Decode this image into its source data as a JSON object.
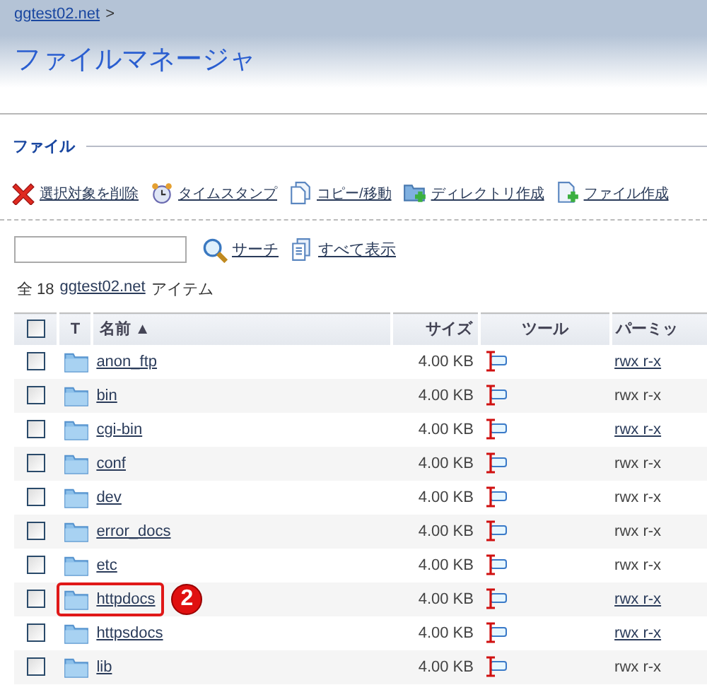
{
  "breadcrumb": {
    "link": "ggtest02.net",
    "separator": ">"
  },
  "title": "ファイルマネージャ",
  "section": "ファイル",
  "toolbar": [
    {
      "kind": "delete",
      "label": "選択対象を削除"
    },
    {
      "kind": "timestamp",
      "label": "タイムスタンプ"
    },
    {
      "kind": "copy",
      "label": "コピー/移動"
    },
    {
      "kind": "newdir",
      "label": "ディレクトリ作成"
    },
    {
      "kind": "newfile",
      "label": "ファイル作成"
    }
  ],
  "search": {
    "button": "サーチ",
    "show_all": "すべて表示"
  },
  "count": {
    "prefix": "全 18",
    "link": "ggtest02.net",
    "suffix": "アイテム"
  },
  "table": {
    "all_checked": false,
    "columns": [
      "T",
      "名前 ▲",
      "サイズ",
      "ツール",
      "パーミッ"
    ],
    "rows": [
      {
        "name": "anon_ftp",
        "size": "4.00 KB",
        "perm": "rwx r-x",
        "perm_link": true,
        "checked": false,
        "highlighted": false
      },
      {
        "name": "bin",
        "size": "4.00 KB",
        "perm": "rwx r-x",
        "perm_link": false,
        "checked": false,
        "highlighted": false
      },
      {
        "name": "cgi-bin",
        "size": "4.00 KB",
        "perm": "rwx r-x",
        "perm_link": true,
        "checked": false,
        "highlighted": false
      },
      {
        "name": "conf",
        "size": "4.00 KB",
        "perm": "rwx r-x",
        "perm_link": false,
        "checked": false,
        "highlighted": false
      },
      {
        "name": "dev",
        "size": "4.00 KB",
        "perm": "rwx r-x",
        "perm_link": false,
        "checked": false,
        "highlighted": false
      },
      {
        "name": "error_docs",
        "size": "4.00 KB",
        "perm": "rwx r-x",
        "perm_link": false,
        "checked": false,
        "highlighted": false
      },
      {
        "name": "etc",
        "size": "4.00 KB",
        "perm": "rwx r-x",
        "perm_link": false,
        "checked": false,
        "highlighted": false
      },
      {
        "name": "httpdocs",
        "size": "4.00 KB",
        "perm": "rwx r-x",
        "perm_link": true,
        "checked": false,
        "highlighted": true,
        "callout": "2"
      },
      {
        "name": "httpsdocs",
        "size": "4.00 KB",
        "perm": "rwx r-x",
        "perm_link": true,
        "checked": false,
        "highlighted": false
      },
      {
        "name": "lib",
        "size": "4.00 KB",
        "perm": "rwx r-x",
        "perm_link": false,
        "checked": false,
        "highlighted": false
      }
    ]
  }
}
